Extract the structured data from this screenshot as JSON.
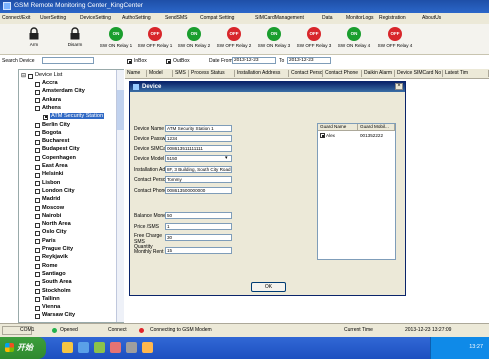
{
  "window": {
    "title": "GSM Remote Monitoring Center_KingCenter"
  },
  "menu": [
    "Connect/Exit",
    "UserSetting",
    "DeviceSetting",
    "AuthoSetting",
    "SendSMS",
    "Compat Setting",
    "SIMCardManagement",
    "Data",
    "MonitorLogs",
    "Registration",
    "AboutUs"
  ],
  "toolbar": [
    {
      "label": "Arm",
      "icon": "lock-icon",
      "kind": "lock"
    },
    {
      "label": "Disarm",
      "icon": "unlock-icon",
      "kind": "lock"
    },
    {
      "label": "SW ON Relay 1",
      "badge": "ON",
      "color": "#1b9e2e"
    },
    {
      "label": "SW OFF Relay 1",
      "badge": "OFF",
      "color": "#d8262b"
    },
    {
      "label": "SW ON Relay 2",
      "badge": "ON",
      "color": "#1b9e2e"
    },
    {
      "label": "SW OFF Relay 2",
      "badge": "OFF",
      "color": "#d8262b"
    },
    {
      "label": "SW ON Relay 3",
      "badge": "ON",
      "color": "#1b9e2e"
    },
    {
      "label": "SW OFF Relay 3",
      "badge": "OFF",
      "color": "#d8262b"
    },
    {
      "label": "SW ON Relay 4",
      "badge": "ON",
      "color": "#1b9e2e"
    },
    {
      "label": "SW OFF Relay 4",
      "badge": "OFF",
      "color": "#d8262b"
    }
  ],
  "filter": {
    "search_label": "Search Device",
    "search_value": "",
    "inbox_label": "InBox",
    "inbox_checked": true,
    "outbox_label": "OutBox",
    "outbox_checked": true,
    "date_from": "2013-12-23",
    "date_label": "Date From",
    "to_label": "To",
    "date_to": "2013-12-23"
  },
  "tree": {
    "root": "Device List",
    "items": [
      {
        "label": "Accra",
        "checked": false,
        "indent": 1
      },
      {
        "label": "Amsterdam City",
        "checked": false,
        "indent": 1
      },
      {
        "label": "Ankara",
        "checked": false,
        "indent": 1
      },
      {
        "label": "Athens",
        "checked": false,
        "indent": 1
      },
      {
        "label": "ATM Security Station",
        "checked": true,
        "indent": 2,
        "selected": true
      },
      {
        "label": "Berlin City",
        "checked": false,
        "indent": 1
      },
      {
        "label": "Bogota",
        "checked": false,
        "indent": 1
      },
      {
        "label": "Bucharest",
        "checked": false,
        "indent": 1
      },
      {
        "label": "Budapest City",
        "checked": false,
        "indent": 1
      },
      {
        "label": "Copenhagen",
        "checked": false,
        "indent": 1
      },
      {
        "label": "East Area",
        "checked": false,
        "indent": 1
      },
      {
        "label": "Helsinki",
        "checked": false,
        "indent": 1
      },
      {
        "label": "Lisbon",
        "checked": false,
        "indent": 1
      },
      {
        "label": "London City",
        "checked": false,
        "indent": 1
      },
      {
        "label": "Madrid",
        "checked": false,
        "indent": 1
      },
      {
        "label": "Moscow",
        "checked": false,
        "indent": 1
      },
      {
        "label": "Nairobi",
        "checked": false,
        "indent": 1
      },
      {
        "label": "North Area",
        "checked": false,
        "indent": 1
      },
      {
        "label": "Oslo City",
        "checked": false,
        "indent": 1
      },
      {
        "label": "Paris",
        "checked": false,
        "indent": 1
      },
      {
        "label": "Prague City",
        "checked": false,
        "indent": 1
      },
      {
        "label": "Reykjavik",
        "checked": false,
        "indent": 1
      },
      {
        "label": "Rome",
        "checked": false,
        "indent": 1
      },
      {
        "label": "Santiago",
        "checked": false,
        "indent": 1
      },
      {
        "label": "South Area",
        "checked": false,
        "indent": 1
      },
      {
        "label": "Stockholm",
        "checked": false,
        "indent": 1
      },
      {
        "label": "Tallinn",
        "checked": false,
        "indent": 1
      },
      {
        "label": "Vienna",
        "checked": false,
        "indent": 1
      },
      {
        "label": "Warsaw City",
        "checked": false,
        "indent": 1
      }
    ]
  },
  "grid": {
    "columns": [
      "Name",
      "Model",
      "SMS",
      "Process Status",
      "Installation Address",
      "Contact Person",
      "Contact Phone",
      "Daikin Alarm",
      "Device SIMCard No",
      "Latest Tim"
    ]
  },
  "dialog": {
    "title": "Device",
    "fields": {
      "device_name": {
        "label": "Device Name",
        "value": "ATM Security Station 1"
      },
      "device_password": {
        "label": "Device Password",
        "value": "1234"
      },
      "device_simcard": {
        "label": "Device SIMCard No.",
        "value": "008613511111111"
      },
      "device_model": {
        "label": "Device Model",
        "value": "5150"
      },
      "installation_address": {
        "label": "Installation Address",
        "value": "8F, 3 Building, South City Road"
      },
      "contact_person": {
        "label": "Contact Person Name",
        "value": "Tommy"
      },
      "contact_phone": {
        "label": "Contact Phone",
        "value": "008613500000000"
      },
      "balance_money": {
        "label": "Balance Money",
        "value": "50"
      },
      "price_sms": {
        "label": "Price /SMS",
        "value": "1"
      },
      "free_charge_sms": {
        "label": "Free Charge SMS Quantity",
        "value": "30"
      },
      "monthly_rent": {
        "label": "Monthly Rent Fee",
        "value": "15"
      }
    },
    "guard_table": {
      "columns": [
        "Guard Name",
        "Guard Mobil..."
      ],
      "rows": [
        {
          "name": "Alex",
          "mobile": "001352222",
          "checked": true
        }
      ]
    },
    "ok_label": "OK"
  },
  "status": {
    "port": "COM1",
    "port_state": "Opened",
    "connect_label": "Connect",
    "connect_state": "Connecting to GSM Modem",
    "time_label": "Current Time",
    "time_value": "2013-12-23 13:27:09"
  },
  "taskbar": {
    "start_label": "开始",
    "clock": "13:27"
  }
}
